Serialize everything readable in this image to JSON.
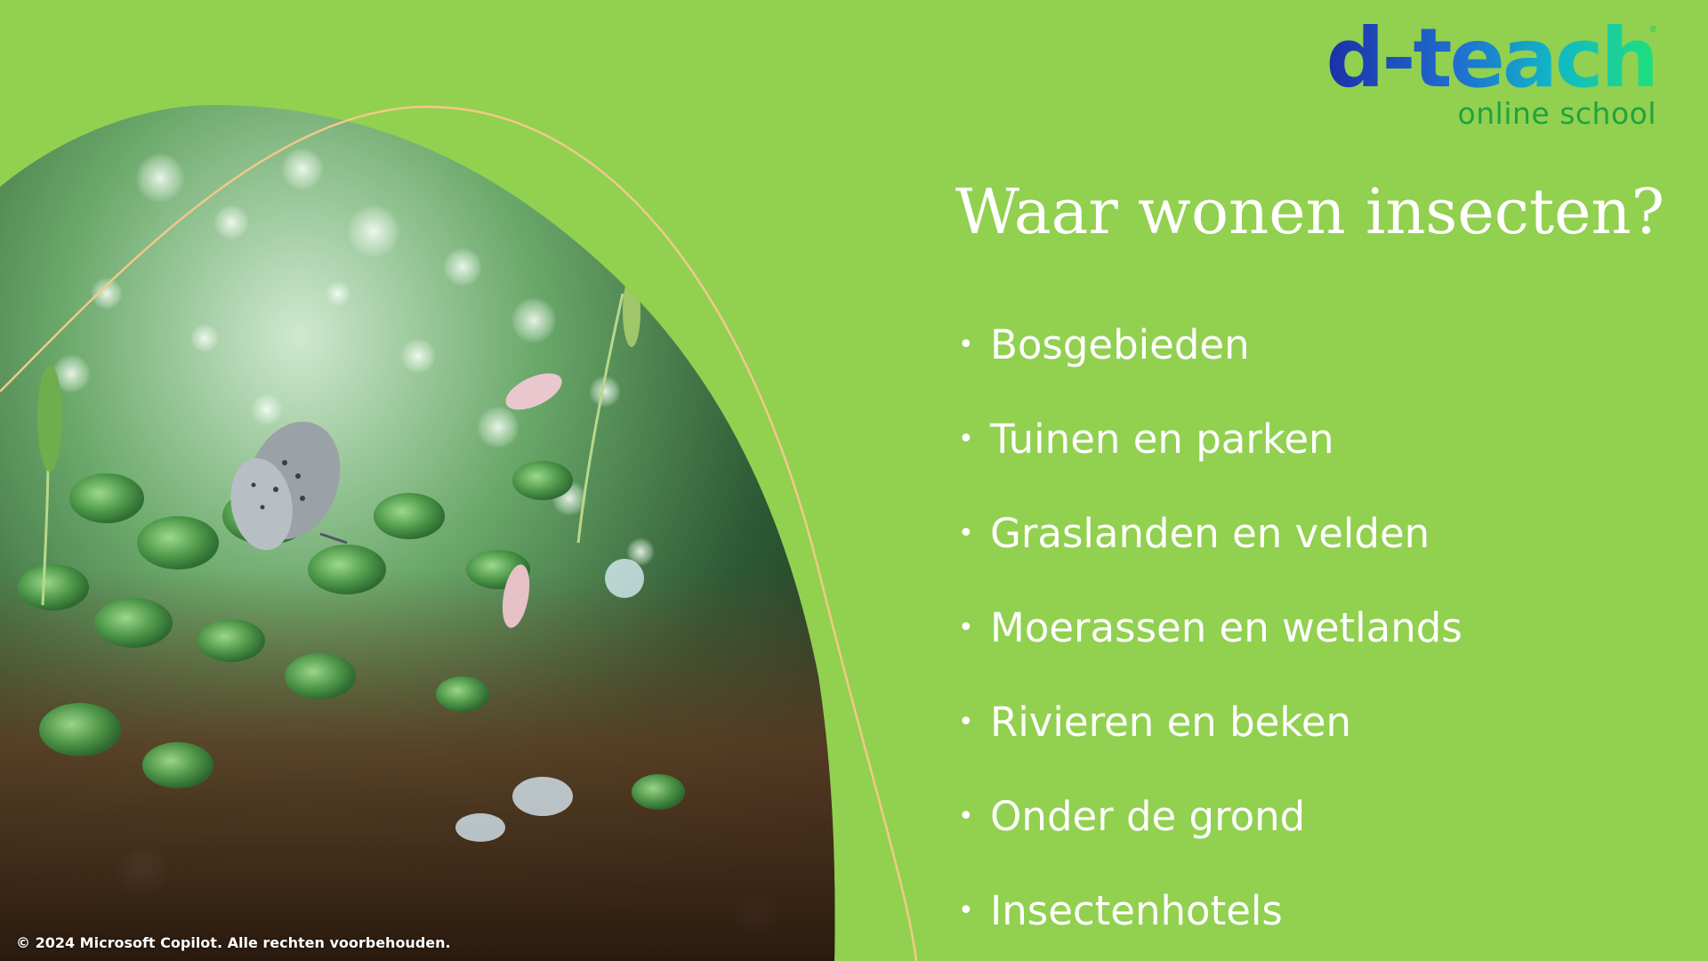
{
  "logo": {
    "word": "d-teach",
    "subtitle": "online school",
    "registered": "®"
  },
  "title": "Waar wonen insecten?",
  "items": [
    "Bosgebieden",
    "Tuinen en parken",
    "Graslanden en velden",
    "Moerassen en wetlands",
    "Rivieren en beken",
    "Onder de grond",
    "Insectenhotels"
  ],
  "copyright": "© 2024 Microsoft Copilot. Alle rechten voorbehouden.",
  "colors": {
    "background": "#92d050",
    "text": "#ffffff",
    "arc_line": "#f2c98a",
    "logo_subtitle": "#1fa33c"
  },
  "icons": {
    "bullet": "bullet-icon",
    "photo": "nature-photo-butterfly-moss"
  }
}
